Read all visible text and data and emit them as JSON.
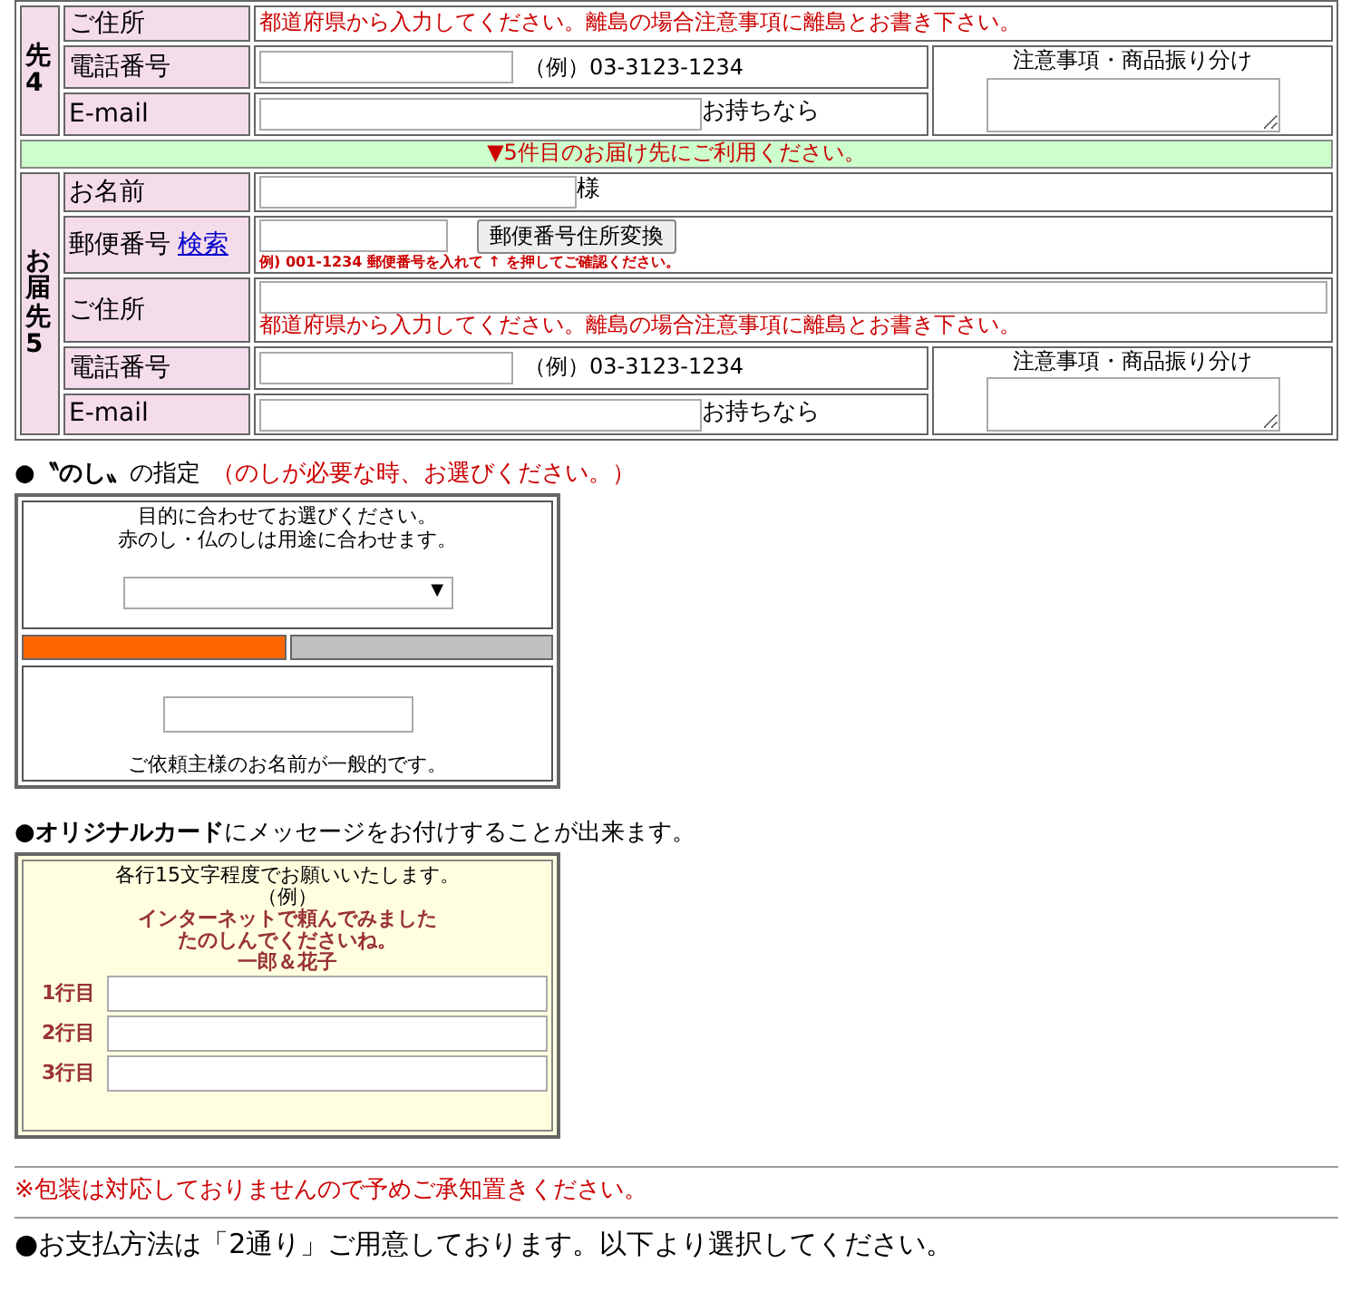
{
  "destinations": [
    {
      "side_label": "先4",
      "address_label": "ご住所",
      "address_hint": "都道府県から入力してください。離島の場合注意事項に離島とお書き下さい。",
      "phone_label": "電話番号",
      "phone_example": "（例）03-3123-1234",
      "email_label": "E-mail",
      "email_suffix": "お持ちなら",
      "notes_label": "注意事項・商品振り分け"
    },
    {
      "banner": "▼5件目のお届け先にご利用ください。",
      "side_label": "お届先5",
      "name_label": "お名前",
      "name_suffix": "様",
      "postal_label": "郵便番号",
      "search_link": "検索",
      "convert_button": "郵便番号住所変換",
      "postal_hint": "例) 001-1234 郵便番号を入れて ↑ を押してご確認ください。",
      "address_label": "ご住所",
      "address_hint": "都道府県から入力してください。離島の場合注意事項に離島とお書き下さい。",
      "phone_label": "電話番号",
      "phone_example": "（例）03-3123-1234",
      "email_label": "E-mail",
      "email_suffix": "お持ちなら",
      "notes_label": "注意事項・商品振り分け"
    }
  ],
  "noshi": {
    "title": "●**〝のし〟**の指定",
    "title_note": "（のしが必要な時、お選びください。）",
    "instructions": [
      "目的に合わせてお選びください。",
      "赤のし・仏のしは用途に合わせます。"
    ],
    "select_arrow": "▼",
    "tabs": [
      {
        "selected": true
      },
      {
        "selected": false
      }
    ],
    "caption": "ご依頼主様のお名前が一般的です。"
  },
  "card": {
    "title": "●**オリジナルカード**にメッセージをお付けすることが出来ます。",
    "instruction": "各行15文字程度でお願いいたします。",
    "example_label": "（例）",
    "example_lines": [
      "インターネットで頼んでみました",
      "たのしんでくださいね。",
      "一郎＆花子"
    ],
    "line_labels": [
      "1行目",
      "2行目",
      "3行目"
    ]
  },
  "wrapping_notice": "※包装は対応しておりませんので予めご承知置きください。",
  "payment_heading": "●お支払方法は「2通り」ご用意しております。以下より選択してください。"
}
